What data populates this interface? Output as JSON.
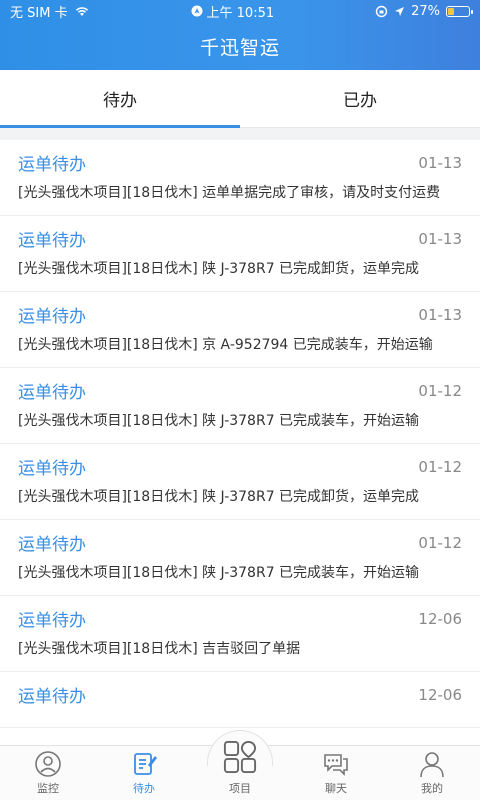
{
  "status_bar": {
    "carrier": "无 SIM 卡",
    "time": "上午 10:51",
    "battery": "27%"
  },
  "header": {
    "title": "千迅智运"
  },
  "tabs": [
    {
      "label": "待办",
      "active": true
    },
    {
      "label": "已办",
      "active": false
    }
  ],
  "items": [
    {
      "title": "运单待办",
      "date": "01-13",
      "text": "[光头强伐木项目][18日伐木] 运单单据完成了审核，请及时支付运费"
    },
    {
      "title": "运单待办",
      "date": "01-13",
      "text": "[光头强伐木项目][18日伐木] 陕 J-378R7 已完成卸货，运单完成"
    },
    {
      "title": "运单待办",
      "date": "01-13",
      "text": "[光头强伐木项目][18日伐木] 京 A-952794 已完成装车，开始运输"
    },
    {
      "title": "运单待办",
      "date": "01-12",
      "text": "[光头强伐木项目][18日伐木] 陕 J-378R7 已完成装车，开始运输"
    },
    {
      "title": "运单待办",
      "date": "01-12",
      "text": "[光头强伐木项目][18日伐木] 陕 J-378R7 已完成卸货，运单完成"
    },
    {
      "title": "运单待办",
      "date": "01-12",
      "text": "[光头强伐木项目][18日伐木] 陕 J-378R7 已完成装车，开始运输"
    },
    {
      "title": "运单待办",
      "date": "12-06",
      "text": "[光头强伐木项目][18日伐木] 吉吉驳回了单据"
    },
    {
      "title": "运单待办",
      "date": "12-06",
      "text": ""
    }
  ],
  "nav": [
    {
      "label": "监控",
      "icon": "monitor-icon"
    },
    {
      "label": "待办",
      "icon": "todo-icon"
    },
    {
      "label": "项目",
      "icon": "project-icon"
    },
    {
      "label": "聊天",
      "icon": "chat-icon"
    },
    {
      "label": "我的",
      "icon": "user-icon"
    }
  ],
  "colors": {
    "accent": "#3a8ee6",
    "header": "#3a95ea"
  }
}
